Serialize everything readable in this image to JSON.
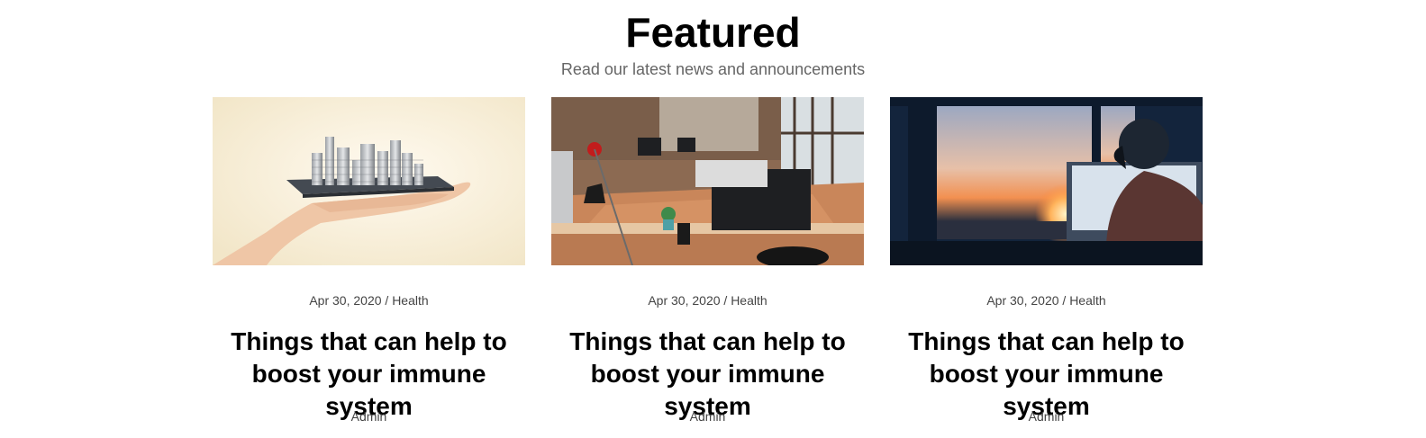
{
  "section": {
    "title": "Featured",
    "subtitle": "Read our latest news and announcements"
  },
  "posts": [
    {
      "image": "hand-holding-city-image",
      "date": "Apr 30, 2020",
      "separator": "/",
      "category": "Health",
      "title": "Things that can help to boost your immune system",
      "author": "Admin"
    },
    {
      "image": "office-desks-image",
      "date": "Apr 30, 2020",
      "separator": "/",
      "category": "Health",
      "title": "Things that can help to boost your immune system",
      "author": "Admin"
    },
    {
      "image": "sunset-window-image",
      "date": "Apr 30, 2020",
      "separator": "/",
      "category": "Health",
      "title": "Things that can help to boost your immune system",
      "author": "Admin"
    }
  ]
}
